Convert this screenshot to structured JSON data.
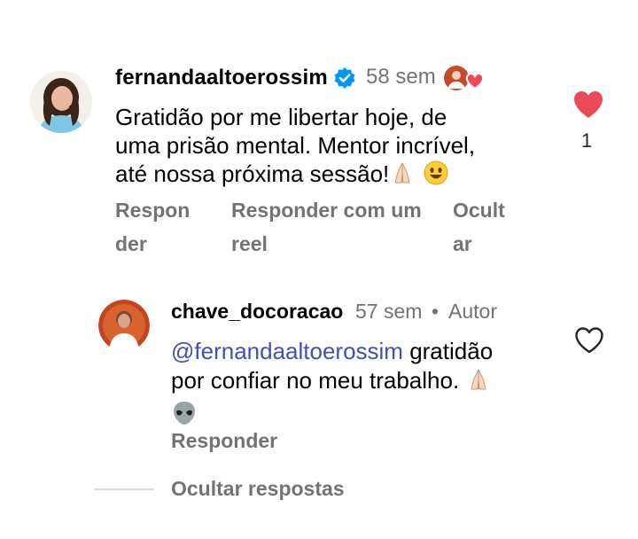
{
  "comment": {
    "username": "fernandaaltoerossim",
    "time": "58 sem",
    "text_line1": "Gratidão por me libertar hoje, de",
    "text_line2": "uma prisão mental. Mentor incrível,",
    "text_line3": "até nossa próxima sessão!",
    "emojis": [
      "folded-hands-icon",
      "smiling-face-icon"
    ],
    "actions": {
      "reply_a": "Respon",
      "reply_b": "der",
      "reel_a": "Responder com um",
      "reel_b": "reel",
      "hide_a": "Ocult",
      "hide_b": "ar"
    },
    "like_count": "1",
    "liked": true,
    "like_color": "#ed4956"
  },
  "reply": {
    "username": "chave_docoracao",
    "time": "57 sem",
    "separator": "•",
    "author_label": "Autor",
    "mention": "@fernandaaltoerossim",
    "text_a": " gratidão",
    "text_b": "por confiar no meu trabalho.",
    "emojis": [
      "folded-hands-icon",
      "alien-icon"
    ],
    "reply_label": "Responder",
    "liked": false
  },
  "hide_replies_label": "Ocultar respostas",
  "colors": {
    "secondary_text": "#737373",
    "mention": "#4150b3",
    "verified": "#0095f6",
    "like_red": "#ed4956"
  }
}
